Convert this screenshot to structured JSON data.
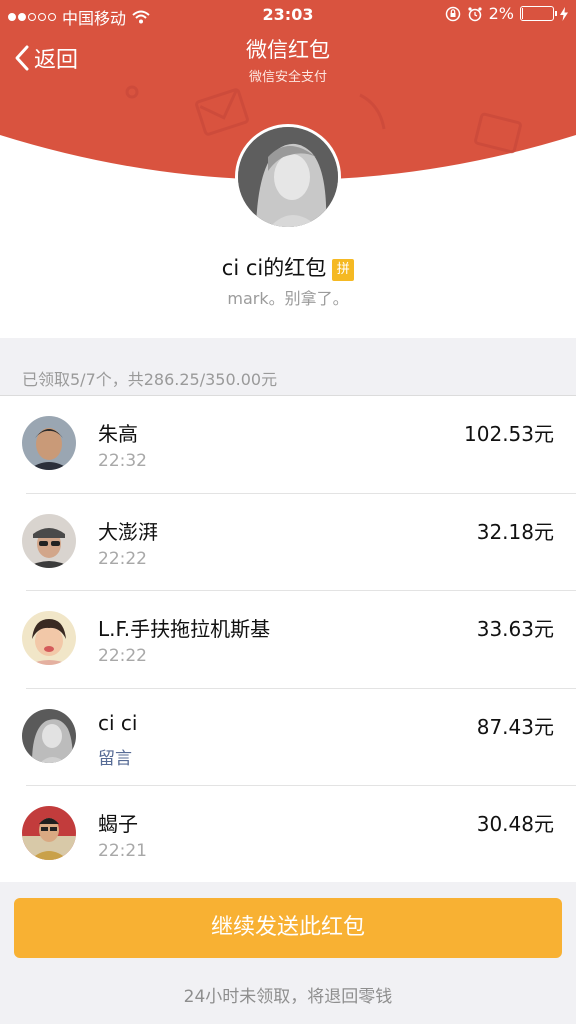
{
  "status_bar": {
    "carrier": "中国移动",
    "time": "23:03",
    "battery_percent": "2%",
    "battery_level": 0.02,
    "signal_filled": 2,
    "signal_total": 5
  },
  "nav": {
    "back_label": "返回",
    "title": "微信红包",
    "subtitle": "微信安全支付"
  },
  "packet": {
    "sender_name": "ci ci的红包",
    "type_badge": "拼",
    "message": "mark。别拿了。"
  },
  "summary": "已领取5/7个，共286.25/350.00元",
  "recipients": [
    {
      "name": "朱高",
      "time": "22:32",
      "amount": "102.53元"
    },
    {
      "name": "大澎湃",
      "time": "22:22",
      "amount": "32.18元"
    },
    {
      "name": "L.F.手扶拖拉机斯基",
      "time": "22:22",
      "amount": "33.63元"
    },
    {
      "name": "ci ci",
      "time": "留言",
      "amount": "87.43元"
    },
    {
      "name": "蝎子",
      "time": "22:21",
      "amount": "30.48元"
    }
  ],
  "actions": {
    "resend_label": "继续发送此红包",
    "footer_note": "24小时未领取，将退回零钱"
  },
  "colors": {
    "header_red": "#d9533f",
    "button_orange": "#f8b133",
    "badge_yellow": "#f5b923",
    "link_blue": "#576b95"
  }
}
